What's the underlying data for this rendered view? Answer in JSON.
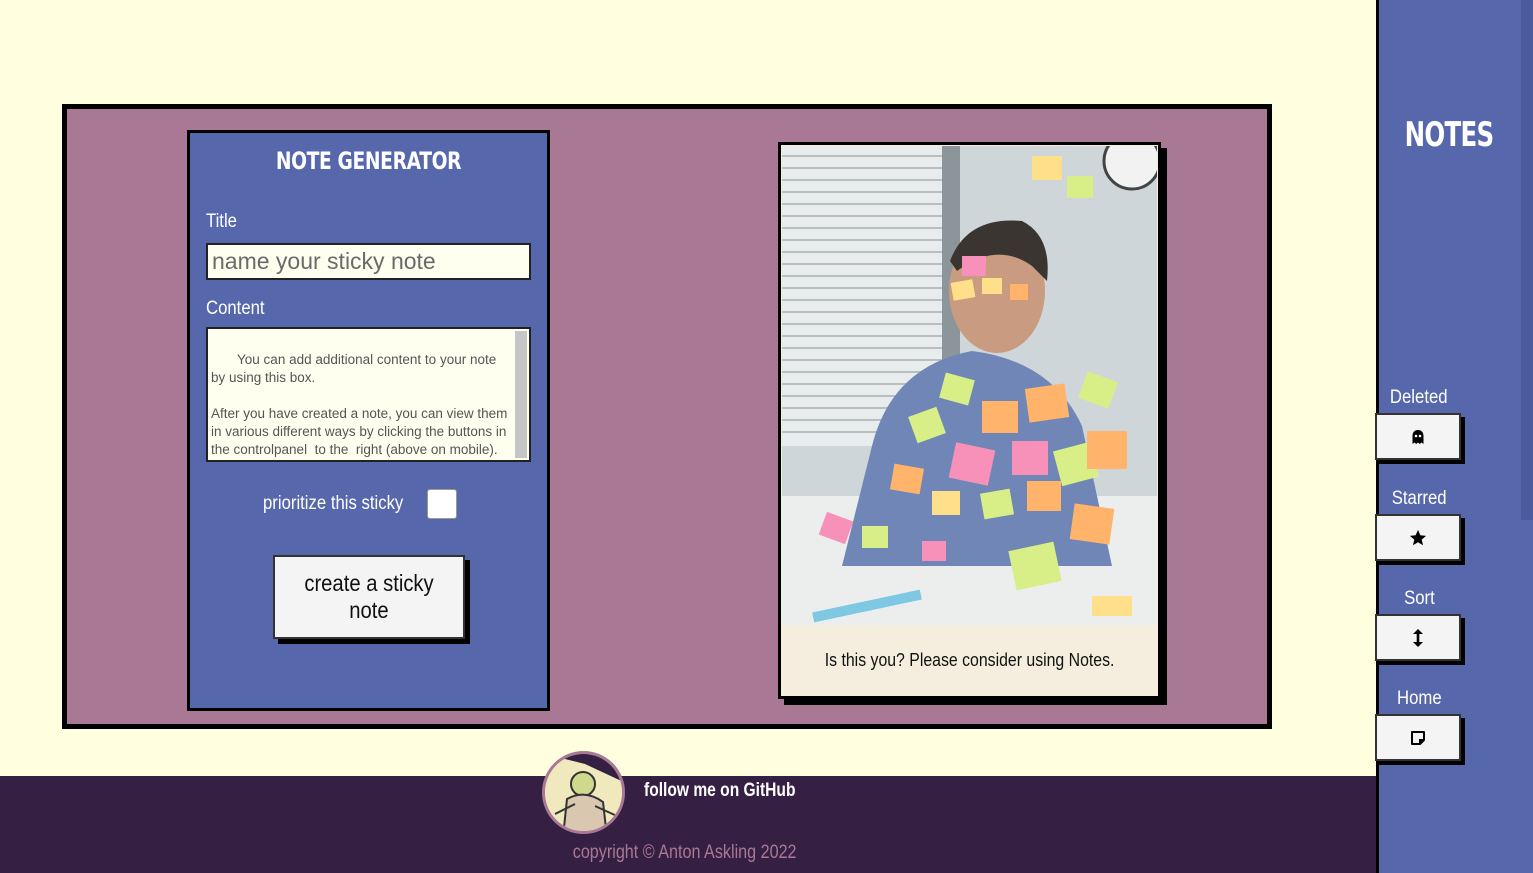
{
  "generator": {
    "heading": "Note Generator",
    "title_label": "Title",
    "title_placeholder": "name your sticky note",
    "content_label": "Content",
    "content_value": " You can add additional content to your note by using this box.\n\nAfter you have created a note, you can view them in various different ways by clicking the buttons in the controlpanel  to the  right (above on mobile). Try them out!",
    "prioritize_label": "prioritize this sticky",
    "prioritize_checked": false,
    "create_button": "create a sticky note"
  },
  "card": {
    "caption": "Is this you? Please consider using Notes."
  },
  "sidebar": {
    "title": "Notes",
    "items": [
      {
        "label": "Deleted",
        "icon": "ghost-icon"
      },
      {
        "label": "Starred",
        "icon": "star-icon"
      },
      {
        "label": "Sort",
        "icon": "sort-arrows-icon"
      },
      {
        "label": "Home",
        "icon": "sticky-note-icon"
      }
    ]
  },
  "footer": {
    "github_link": "follow me on GitHub",
    "copyright": "copyright © Anton Askling 2022"
  },
  "colors": {
    "background": "#ffffdf",
    "frame": "#a97895",
    "panel": "#5767ab",
    "footer": "#352044",
    "card": "#f5eede"
  }
}
